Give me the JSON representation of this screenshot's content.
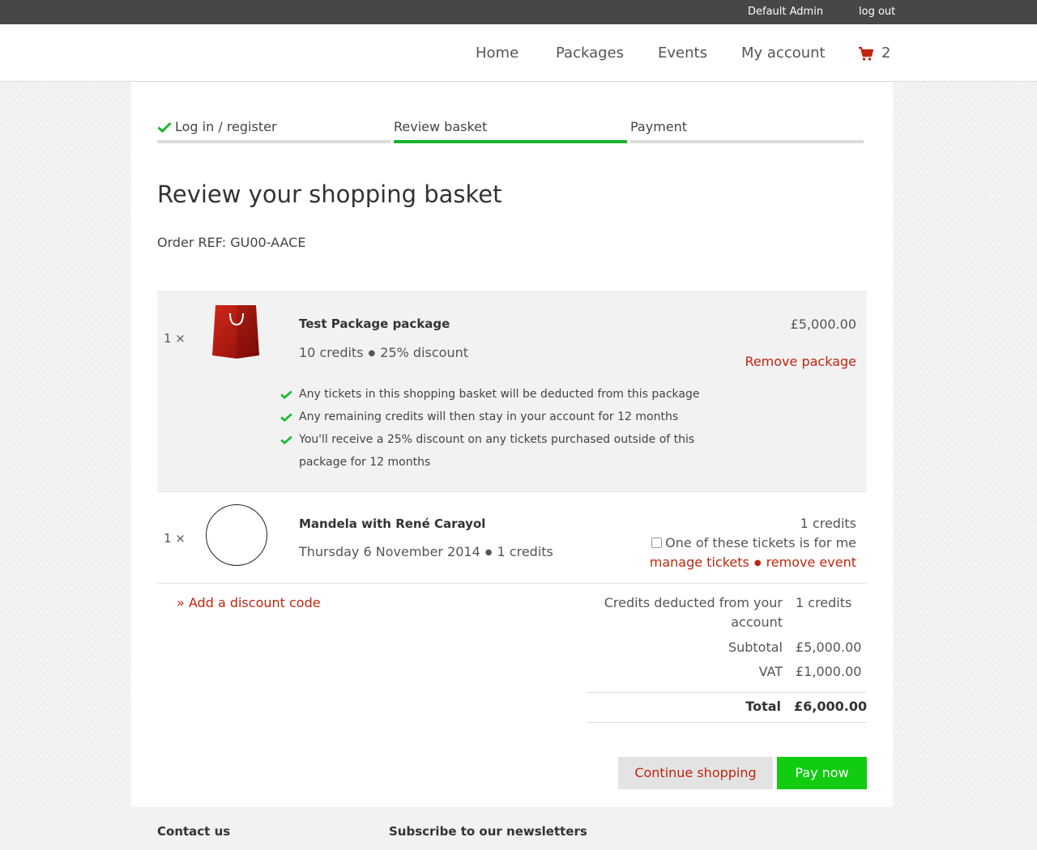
{
  "topbar": {
    "user": "Default Admin",
    "logout": "log out"
  },
  "nav": {
    "items": [
      "Home",
      "Packages",
      "Events",
      "My account"
    ],
    "cart_count": "2",
    "cart_icon": "shopping-cart-icon"
  },
  "steps": [
    "Log in / register",
    "Review basket",
    "Payment"
  ],
  "steps_state": {
    "completed": 1,
    "active": 2
  },
  "colors": {
    "accent": "#c0250f",
    "success": "#17b72d",
    "pay_button": "#11cc11"
  },
  "page": {
    "title": "Review your shopping basket",
    "order_ref": "Order REF: GU00-AACE"
  },
  "package_item": {
    "qty": "1 ×",
    "icon": "shopping-bag-icon",
    "name": "Test Package package",
    "credits": "10 credits",
    "discount": "25% discount",
    "price": "£5,000.00",
    "remove": "Remove package",
    "features": [
      "Any tickets in this shopping basket will be deducted from this package",
      "Any remaining credits will then stay in your account for 12 months",
      "You'll receive a 25% discount on any tickets purchased outside of this package for 12 months"
    ]
  },
  "event_item": {
    "qty": "1 ×",
    "name": "Mandela with René Carayol",
    "date": "Thursday 6 November 2014",
    "credits": "1 credits",
    "price": "1 credits",
    "for_me": "One of these tickets is for me",
    "manage": "manage tickets",
    "remove": "remove event"
  },
  "discount_link": "» Add a discount code",
  "totals": {
    "credits_label_1": "Credits deducted from your",
    "credits_label_2": "account",
    "credits_value": "1 credits",
    "subtotal_label": "Subtotal",
    "subtotal_value": "£5,000.00",
    "vat_label": "VAT",
    "vat_value": "£1,000.00",
    "total_label": "Total",
    "total_value": "£6,000.00"
  },
  "buttons": {
    "continue": "Continue shopping",
    "pay": "Pay now"
  },
  "footer": {
    "contact": "Contact us",
    "newsletter": "Subscribe to our newsletters"
  }
}
